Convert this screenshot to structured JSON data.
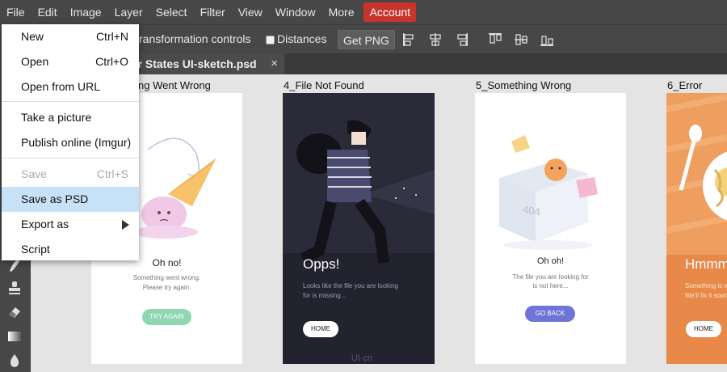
{
  "menubar": {
    "items": [
      "File",
      "Edit",
      "Image",
      "Layer",
      "Select",
      "Filter",
      "View",
      "Window",
      "More"
    ],
    "account": "Account"
  },
  "options": {
    "transform": "ransformation controls",
    "distances": "Distances",
    "get_png": "Get PNG"
  },
  "tab": {
    "title": "or States UI-sketch.psd",
    "close": "×"
  },
  "file_menu": {
    "items": [
      {
        "label": "New",
        "shortcut": "Ctrl+N"
      },
      {
        "label": "Open",
        "shortcut": "Ctrl+O"
      },
      {
        "label": "Open from URL",
        "shortcut": ""
      },
      {
        "label": "Take a picture",
        "shortcut": ""
      },
      {
        "label": "Publish online (Imgur)",
        "shortcut": ""
      },
      {
        "label": "Save",
        "shortcut": "Ctrl+S",
        "disabled": true
      },
      {
        "label": "Save as PSD",
        "shortcut": "",
        "highlighted": true
      },
      {
        "label": "Export as",
        "shortcut": "",
        "submenu": true
      },
      {
        "label": "Script",
        "shortcut": ""
      }
    ]
  },
  "artboards": [
    {
      "label": "ng Went Wrong",
      "title": "Oh no!",
      "body1": "Something went wrong.",
      "body2": "Please try again.",
      "button": "TRY AGAIN"
    },
    {
      "label": "4_File Not Found",
      "title": "Opps!",
      "body1": "Looks like the file you are looking",
      "body2": "for is missing...",
      "button": "HOME",
      "watermark": "UI·cn"
    },
    {
      "label": "5_Something Wrong",
      "title": "Oh oh!",
      "body1": "The file you are looking for",
      "body2": "is not here...",
      "button": "GO BACK",
      "box_text": "404"
    },
    {
      "label": "6_Error",
      "title": "Hmmm",
      "body1": "Something is wrong.",
      "body2": "We'll fix it soon",
      "button": "HOME"
    }
  ],
  "colors": {
    "menubar": "#474747",
    "account": "#c8342c",
    "highlight": "#c7e2f7",
    "dark_artboard": "#2a2a38",
    "orange_artboard": "#e8894a",
    "green_button": "#8fd7b0",
    "purple_button": "#6f75d8"
  }
}
